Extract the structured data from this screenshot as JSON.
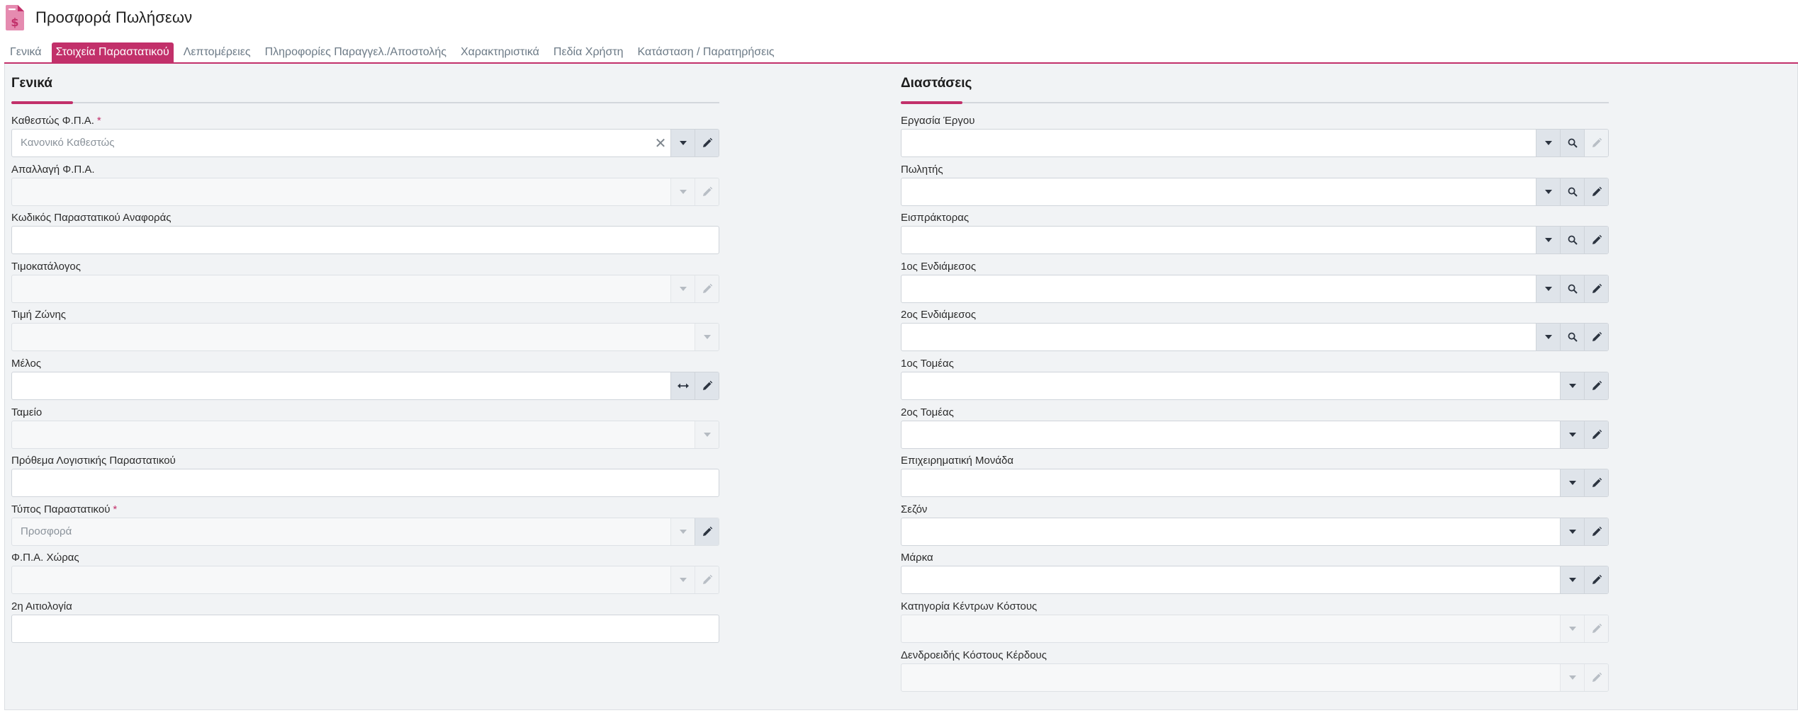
{
  "page": {
    "title": "Προσφορά Πωλήσεων"
  },
  "tabs": [
    {
      "label": "Γενικά",
      "active": false
    },
    {
      "label": "Στοιχεία Παραστατικού",
      "active": true
    },
    {
      "label": "Λεπτομέρειες",
      "active": false
    },
    {
      "label": "Πληροφορίες Παραγγελ./Αποστολής",
      "active": false
    },
    {
      "label": "Χαρακτηριστικά",
      "active": false
    },
    {
      "label": "Πεδία Χρήστη",
      "active": false
    },
    {
      "label": "Κατάσταση / Παρατηρήσεις",
      "active": false
    }
  ],
  "sections": {
    "general": {
      "title": "Γενικά",
      "fields": [
        {
          "label": "Καθεστώς Φ.Π.Α.",
          "required": true,
          "value": "Κανονικό Καθεστώς",
          "disabled": false
        },
        {
          "label": "Απαλλαγή Φ.Π.Α.",
          "required": false,
          "value": "",
          "disabled": true
        },
        {
          "label": "Κωδικός Παραστατικού Αναφοράς",
          "required": false,
          "value": "",
          "disabled": false
        },
        {
          "label": "Τιμοκατάλογος",
          "required": false,
          "value": "",
          "disabled": true
        },
        {
          "label": "Τιμή Ζώνης",
          "required": false,
          "value": "",
          "disabled": true
        },
        {
          "label": "Μέλος",
          "required": false,
          "value": "",
          "disabled": false
        },
        {
          "label": "Ταμείο",
          "required": false,
          "value": "",
          "disabled": true
        },
        {
          "label": "Πρόθεμα Λογιστικής Παραστατικού",
          "required": false,
          "value": "",
          "disabled": false
        },
        {
          "label": "Τύπος Παραστατικού",
          "required": true,
          "value": "Προσφορά",
          "disabled": true
        },
        {
          "label": "Φ.Π.Α. Χώρας",
          "required": false,
          "value": "",
          "disabled": true
        },
        {
          "label": "2η Αιτιολογία",
          "required": false,
          "value": "",
          "disabled": false
        }
      ]
    },
    "dimensions": {
      "title": "Διαστάσεις",
      "fields": [
        {
          "label": "Εργασία Έργου",
          "value": "",
          "disabled": false
        },
        {
          "label": "Πωλητής",
          "value": "",
          "disabled": false
        },
        {
          "label": "Εισπράκτορας",
          "value": "",
          "disabled": false
        },
        {
          "label": "1ος Ενδιάμεσος",
          "value": "",
          "disabled": false
        },
        {
          "label": "2ος Ενδιάμεσος",
          "value": "",
          "disabled": false
        },
        {
          "label": "1ος Τομέας",
          "value": "",
          "disabled": false
        },
        {
          "label": "2ος Τομέας",
          "value": "",
          "disabled": false
        },
        {
          "label": "Επιχειρηματική Μονάδα",
          "value": "",
          "disabled": false
        },
        {
          "label": "Σεζόν",
          "value": "",
          "disabled": false
        },
        {
          "label": "Μάρκα",
          "value": "",
          "disabled": false
        },
        {
          "label": "Κατηγορία Κέντρων Κόστους",
          "value": "",
          "disabled": true
        },
        {
          "label": "Δενδροειδής Κόστους Κέρδους",
          "value": "",
          "disabled": true
        }
      ]
    }
  },
  "icons": {
    "app": "document-dollar-icon",
    "dropdown": "caret-down-icon",
    "edit": "pencil-icon",
    "search": "magnifier-icon",
    "clear": "close-icon",
    "link": "double-arrow-icon"
  },
  "colors": {
    "accent": "#c2306a",
    "panel_bg": "#f1f3f5",
    "button_bg": "#dfe4ea"
  }
}
